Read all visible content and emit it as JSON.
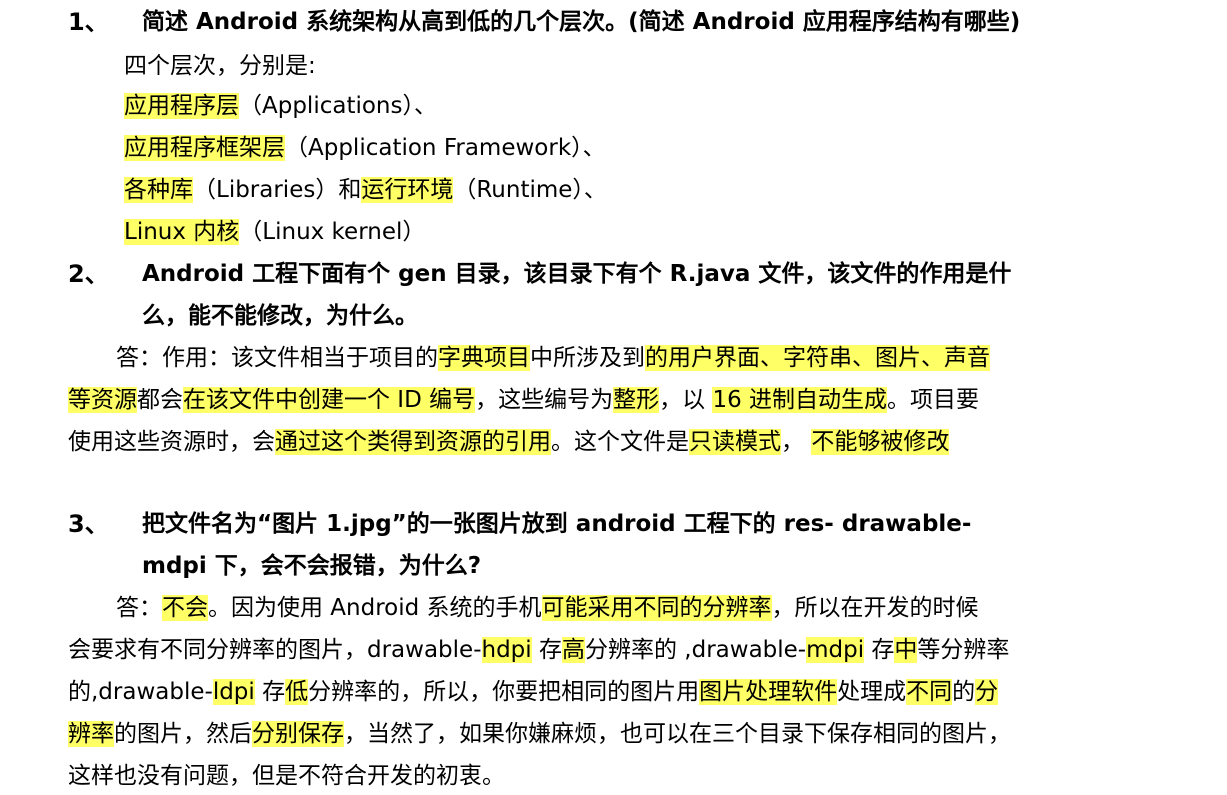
{
  "q1": {
    "number": "1、",
    "title": "简述 Android 系统架构从高到低的几个层次。(简述 Android 应用程序结构有哪些)",
    "intro": "四个层次，分别是:",
    "l1_hl": "应用程序层",
    "l1_rest": "（Applications）、",
    "l2_hl": "应用程序框架层",
    "l2_rest": "（Application Framework）、",
    "l3_hl1": "各种库",
    "l3_mid": "（Libraries）和",
    "l3_hl2": "运行环境",
    "l3_rest": "（Runtime）、",
    "l4_hl": "Linux 内核",
    "l4_rest": "（Linux kernel）"
  },
  "q2": {
    "number": "2、",
    "title_l1": "Android  工程下面有个  gen  目录，该目录下有个  R.java  文件，该文件的作用是什",
    "title_l2": "么，能不能修改，为什么。",
    "a1_a": "答：作用：该文件相当于项目的",
    "a1_hl1": "字典项目",
    "a1_b": "中所涉及到",
    "a1_hl2": "的用户界面、字符串、图片、声音",
    "a2_hl1": "等资源",
    "a2_a": "都会",
    "a2_hl2": "在该文件中创建一个  ID  编号",
    "a2_b": "，这些编号为",
    "a2_hl3": "整形",
    "a2_c": "，以 ",
    "a2_hl4": "16  进制自动生成",
    "a2_d": "。项目要",
    "a3_a": "使用这些资源时，会",
    "a3_hl1": "通过这个类得到资源的引用",
    "a3_b": "。这个文件是",
    "a3_hl2": "只读模式",
    "a3_c": "， ",
    "a3_hl3": "不能够被修改"
  },
  "q3": {
    "number": "3、",
    "title_l1": "把文件名为“图片  1.jpg”的一张图片放到  android  工程下的  res- drawable-",
    "title_l2": "mdpi  下，会不会报错，为什么?",
    "b1_a": "答：",
    "b1_hl1": "不会",
    "b1_b": "。因为使用  Android  系统的手机",
    "b1_hl2": "可能采用不同的分辨率",
    "b1_c": "，所以在开发的时候",
    "b2_a": "会要求有不同分辨率的图片，drawable-",
    "b2_hl1": "hdpi",
    "b2_b": " 存",
    "b2_hl2": "高",
    "b2_c": "分辨率的 ,drawable-",
    "b2_hl3": "mdpi",
    "b2_d": " 存",
    "b2_hl4": "中",
    "b2_e": "等分辨率",
    "b3_a": "的,drawable-",
    "b3_hl1": "ldpi",
    "b3_b": " 存",
    "b3_hl2": "低",
    "b3_c": "分辨率的，所以，你要把相同的图片用",
    "b3_hl3": "图片处理软件",
    "b3_d": "处理成",
    "b3_hl4": "不同",
    "b3_e": "的",
    "b3_hl5": "分",
    "b4_hl1": "辨率",
    "b4_a": "的图片，然后",
    "b4_hl2": "分别保存",
    "b4_b": "，当然了，如果你嫌麻烦，也可以在三个目录下保存相同的图片，",
    "b5": "这样也没有问题，但是不符合开发的初衷。"
  }
}
